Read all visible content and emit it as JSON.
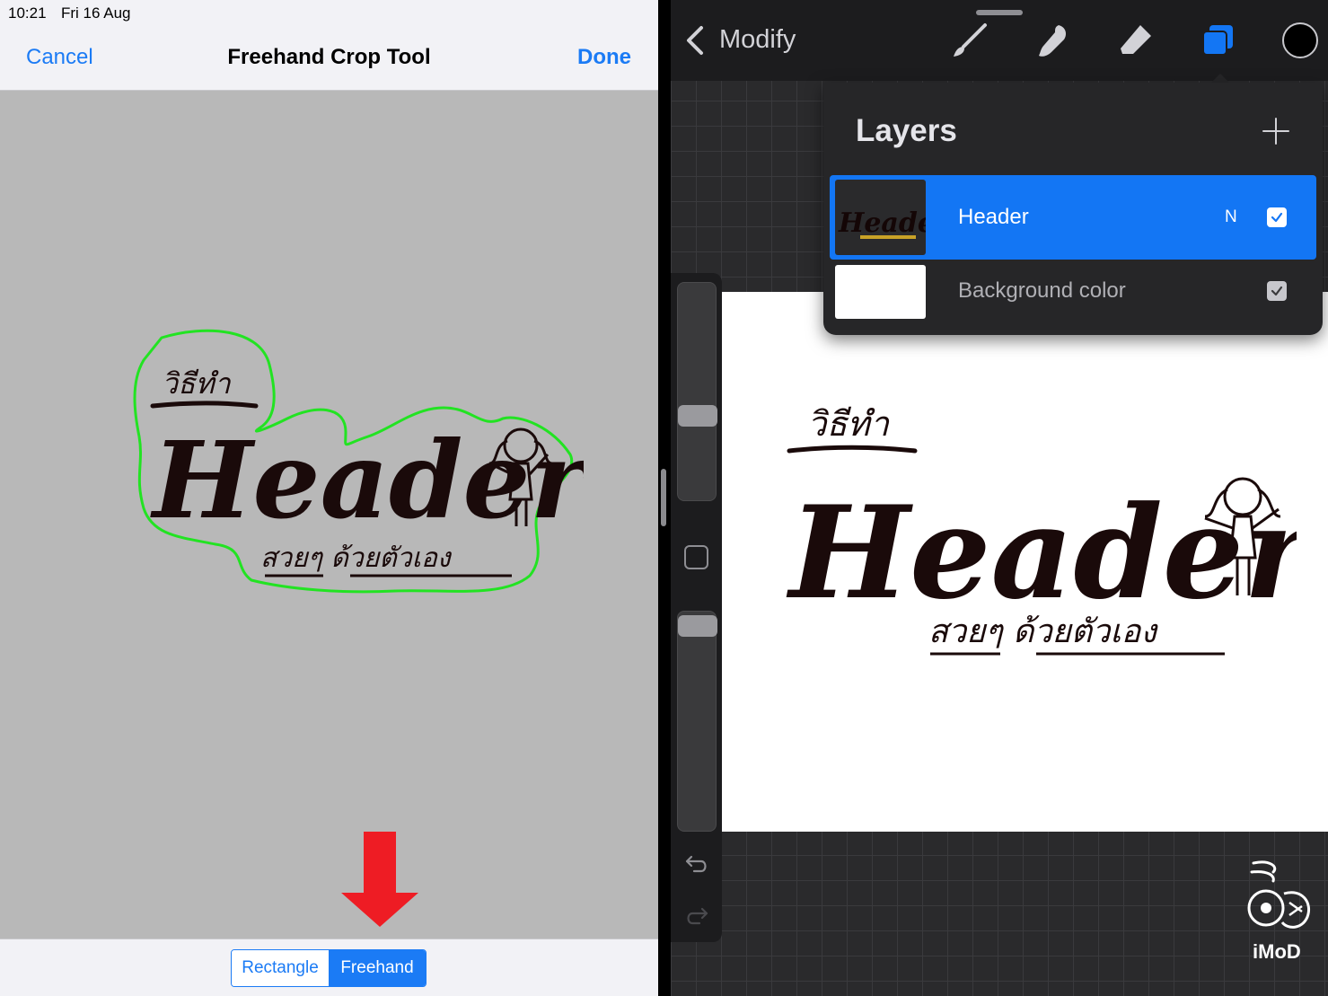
{
  "status_bar": {
    "time": "10:21",
    "date": "Fri 16 Aug"
  },
  "crop_tool": {
    "title": "Freehand Crop Tool",
    "cancel_label": "Cancel",
    "done_label": "Done",
    "artwork": {
      "title_text": "Header",
      "thai_top": "วิธีทำ",
      "thai_bottom": "สวยๆ ด้วยตัวเอง"
    },
    "modes": [
      {
        "label": "Rectangle",
        "selected": false
      },
      {
        "label": "Freehand",
        "selected": true
      }
    ],
    "selection_outline_color": "#22e322",
    "arrow_color": "#ee1c24"
  },
  "procreate": {
    "modify_label": "Modify",
    "tools": [
      "brush-icon",
      "smudge-icon",
      "eraser-icon",
      "layers-icon"
    ],
    "active_tool": "layers-icon",
    "current_color": "#000000",
    "accent_color": "#1376f4",
    "layers_panel": {
      "title": "Layers",
      "layers": [
        {
          "name": "Header",
          "blend_mode": "N",
          "visible": true,
          "selected": true
        },
        {
          "name": "Background color",
          "visible": true,
          "selected": false
        }
      ]
    },
    "canvas_artwork": {
      "title_text": "Header",
      "thai_top": "วิธีทำ",
      "thai_bottom": "สวยๆ ด้วยตัวเอง"
    }
  },
  "watermark": {
    "label": "iMoD"
  }
}
